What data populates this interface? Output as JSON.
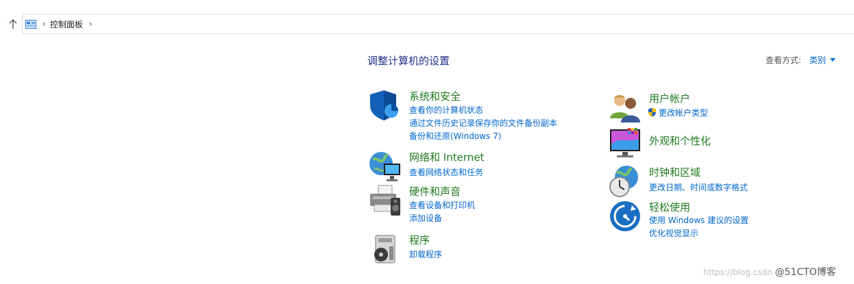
{
  "addressbar": {
    "breadcrumb": [
      "控制面板"
    ]
  },
  "header": {
    "title": "调整计算机的设置",
    "view_by_label": "查看方式:",
    "view_by_value": "类别"
  },
  "categories_left": [
    {
      "title": "系统和安全",
      "links": [
        "查看你的计算机状态",
        "通过文件历史记录保存你的文件备份副本",
        "备份和还原(Windows 7)"
      ]
    },
    {
      "title": "网络和 Internet",
      "links": [
        "查看网络状态和任务"
      ]
    },
    {
      "title": "硬件和声音",
      "links": [
        "查看设备和打印机",
        "添加设备"
      ]
    },
    {
      "title": "程序",
      "links": [
        "卸载程序"
      ]
    }
  ],
  "categories_right": [
    {
      "title": "用户帐户",
      "links": [
        "更改帐户类型"
      ]
    },
    {
      "title": "外观和个性化",
      "links": []
    },
    {
      "title": "时钟和区域",
      "links": [
        "更改日期、时间或数字格式"
      ]
    },
    {
      "title": "轻松使用",
      "links": [
        "使用 Windows 建议的设置",
        "优化视觉显示"
      ]
    }
  ],
  "watermark": {
    "url": "https://blog.csdn",
    "brand": "@51CTO博客"
  }
}
